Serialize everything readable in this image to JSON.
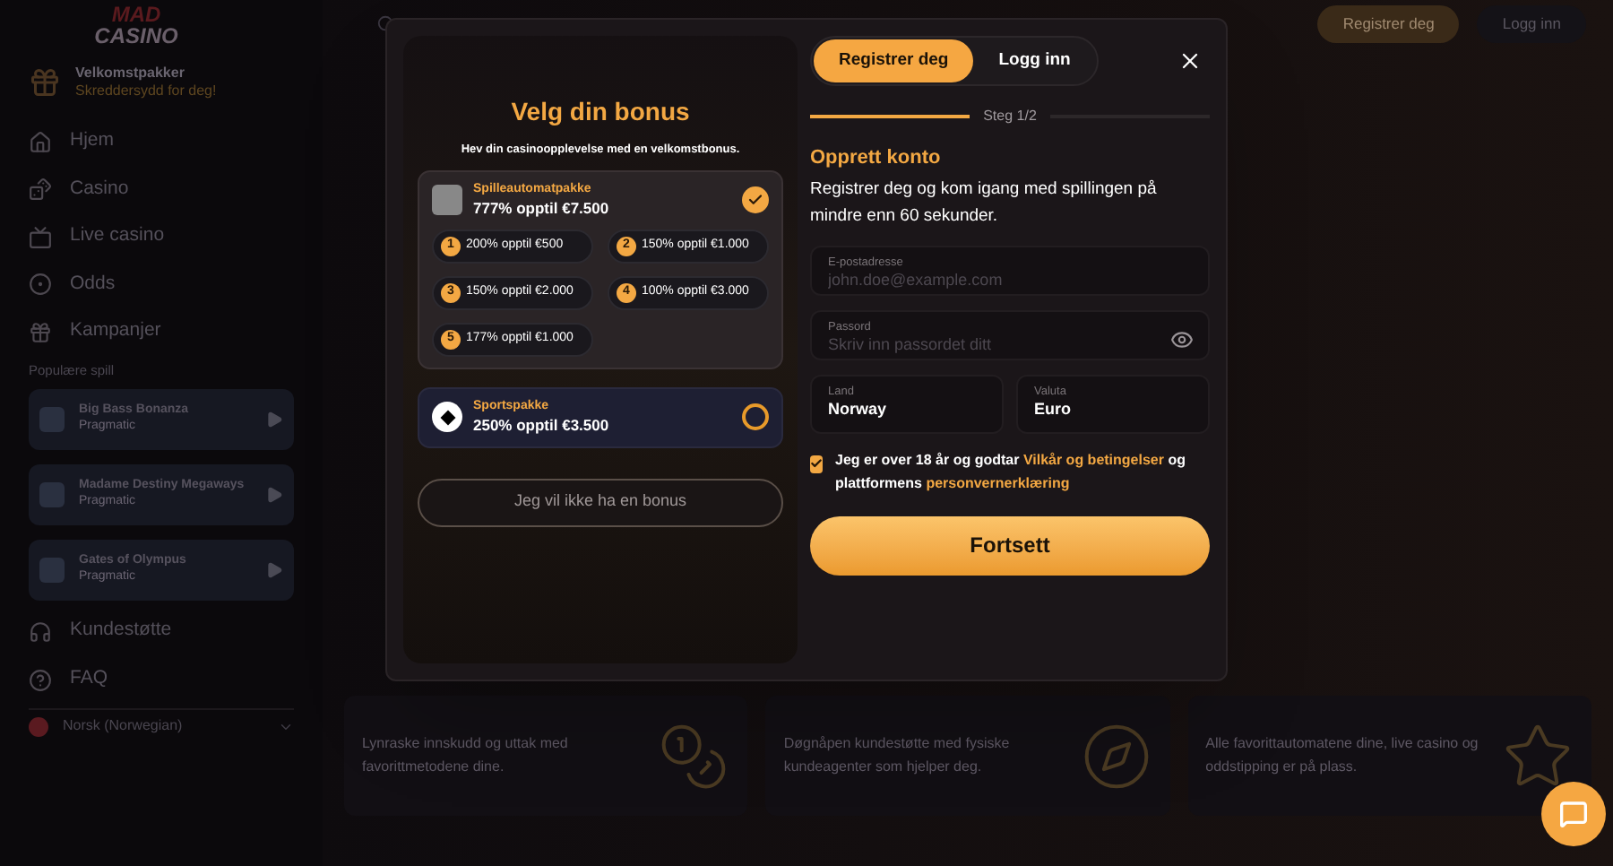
{
  "sidebar": {
    "logo": {
      "line1": "MAD",
      "line2": "CASINO"
    },
    "promo": {
      "title": "Velkomstpakker",
      "subtitle": "Skreddersydd for deg!"
    },
    "nav": [
      {
        "kind": "home",
        "label": "Hjem"
      },
      {
        "kind": "casino",
        "label": "Casino"
      },
      {
        "kind": "live",
        "label": "Live casino"
      },
      {
        "kind": "odds",
        "label": "Odds"
      },
      {
        "kind": "promo",
        "label": "Kampanjer"
      }
    ],
    "section_label": "Populære spill",
    "games": [
      {
        "title": "Big Bass Bonanza",
        "provider": "Pragmatic"
      },
      {
        "title": "Madame Destiny Megaways",
        "provider": "Pragmatic"
      },
      {
        "title": "Gates of Olympus",
        "provider": "Pragmatic"
      }
    ],
    "bottom_nav": [
      {
        "kind": "support",
        "label": "Kundestøtte"
      },
      {
        "kind": "faq",
        "label": "FAQ"
      }
    ],
    "language": "Norsk (Norwegian)"
  },
  "header": {
    "buttons": [
      {
        "kind": "primary",
        "label": "Registrer deg"
      },
      {
        "kind": "secondary",
        "label": "Logg inn"
      }
    ]
  },
  "modal": {
    "bonus": {
      "title": "Velg din bonus",
      "subtitle": "Hev din casinoopplevelse med en velkomstbonus.",
      "packages": [
        {
          "kind": "slots",
          "title": "Spilleautomatpakke",
          "offer": "777% opptil €7.500",
          "selected": true,
          "steps": [
            {
              "number": "1",
              "text": "200% opptil €500"
            },
            {
              "number": "2",
              "text": "150% opptil €1.000"
            },
            {
              "number": "3",
              "text": "150% opptil €2.000"
            },
            {
              "number": "4",
              "text": "100% opptil €3.000"
            },
            {
              "number": "5",
              "text": "177% opptil €1.000"
            }
          ]
        },
        {
          "kind": "sports",
          "title": "Sportspakke",
          "offer": "250% opptil €3.500",
          "selected": false
        }
      ],
      "no_bonus_button": "Jeg vil ikke ha en bonus"
    },
    "form": {
      "tabs": [
        {
          "label": "Registrer deg",
          "selected": true
        },
        {
          "label": "Logg inn",
          "selected": false
        }
      ],
      "progress": {
        "label": "Steg 1/2",
        "level": 0.5
      },
      "heading": "Opprett konto",
      "description": "Registrer deg og kom igang med spillingen på mindre enn 60 sekunder.",
      "email": {
        "label": "E-postadresse",
        "placeholder": "john.doe@example.com"
      },
      "password": {
        "label": "Passord",
        "placeholder": "Skriv inn passordet ditt"
      },
      "country": {
        "label": "Land",
        "value": "Norway"
      },
      "currency": {
        "label": "Valuta",
        "value": "Euro"
      },
      "consent": {
        "checked": true,
        "text_before": "Jeg er over 18 år og godtar",
        "terms_link": "Vilkår og betingelser",
        "text_middle": "og plattformens",
        "privacy_link": "personvernerklæring"
      },
      "submit": "Fortsett"
    }
  },
  "features": [
    {
      "kind": "bag",
      "text": "Lynraske innskudd og uttak med favorittmetodene dine."
    },
    {
      "kind": "watch",
      "text": "Døgnåpen kundestøtte med fysiske kundeagenter som hjelper deg."
    },
    {
      "kind": "star",
      "text": "Alle favorittautomatene dine, live casino og oddstipping er på plass."
    }
  ]
}
